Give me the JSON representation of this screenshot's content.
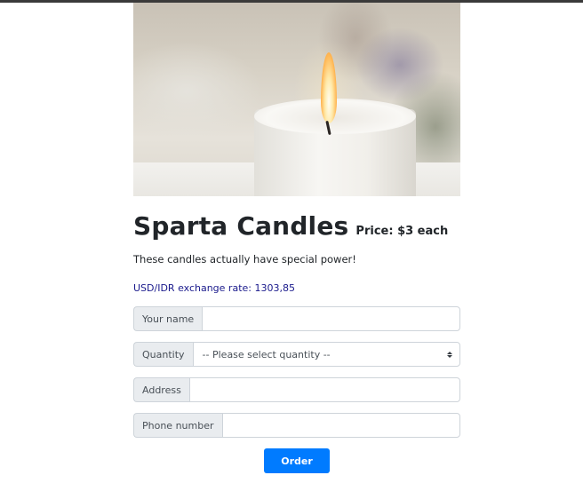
{
  "product": {
    "image_alt": "White pillar candle with lit flame",
    "title": "Sparta Candles",
    "price": "Price: $3 each",
    "description": "These candles actually have special power!",
    "exchange_rate": "USD/IDR exchange rate: 1303,85"
  },
  "form": {
    "name_label": "Your name",
    "name_value": "",
    "quantity_label": "Quantity",
    "quantity_selected": "-- Please select quantity --",
    "address_label": "Address",
    "address_value": "",
    "phone_label": "Phone number",
    "phone_value": "",
    "order_label": "Order"
  },
  "colors": {
    "button": "#007bff",
    "rate_text": "#1a1a8c",
    "addon_bg": "#e9ecef"
  }
}
